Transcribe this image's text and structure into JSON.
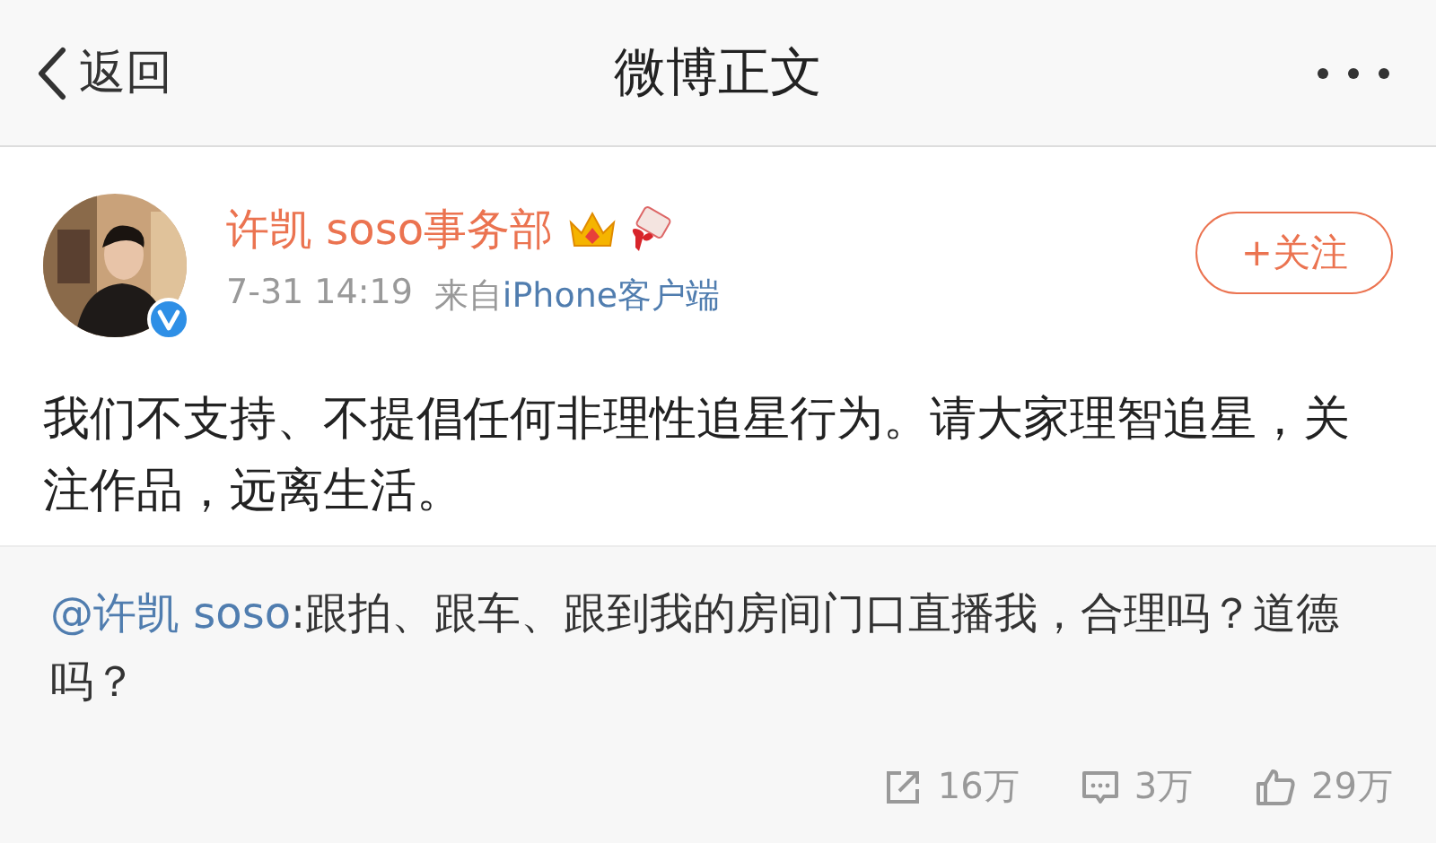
{
  "nav": {
    "back": "返回",
    "title": "微博正文"
  },
  "post": {
    "author": "许凯 soso事务部",
    "time": "7-31 14:19",
    "source_prefix": "来自",
    "source": "iPhone客户端",
    "verified": true,
    "follow": "+关注",
    "text": "我们不支持、不提倡任何非理性追星行为。请大家理智追星，关注作品，远离生活。"
  },
  "repost": {
    "mention": "@许凯 soso",
    "text": ":跟拍、跟车、跟到我的房间门口直播我，合理吗？道德吗？"
  },
  "actions": [
    {
      "kind": "share",
      "count": "16万"
    },
    {
      "kind": "comment",
      "count": "3万"
    },
    {
      "kind": "like",
      "count": "29万"
    }
  ]
}
